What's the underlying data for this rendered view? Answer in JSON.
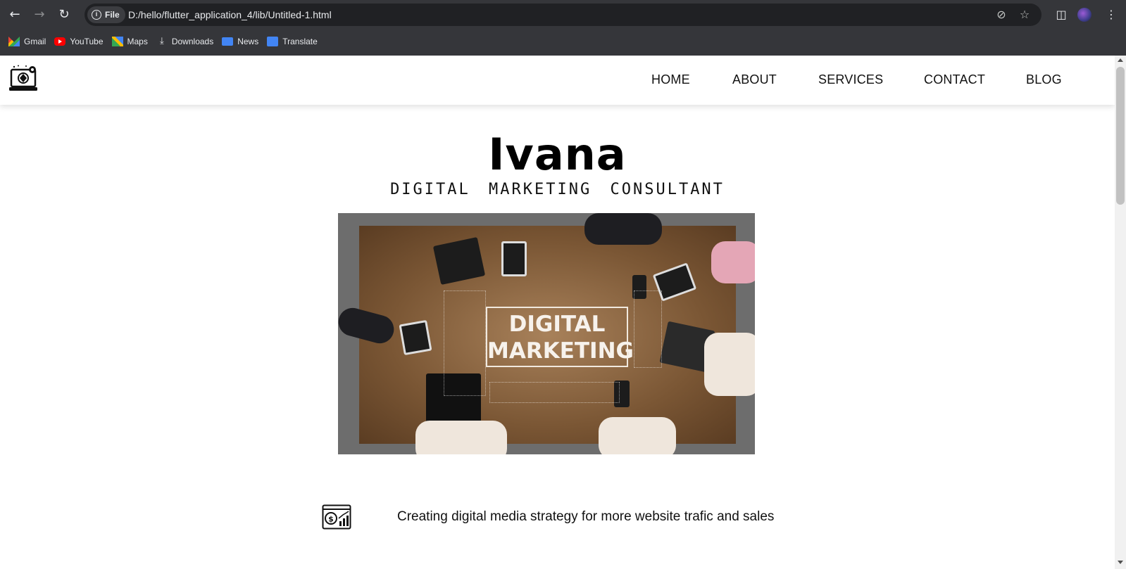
{
  "browser": {
    "file_chip_label": "File",
    "url": "D:/hello/flutter_application_4/lib/Untitled-1.html",
    "icons": {
      "back": "back-arrow-icon",
      "forward": "forward-arrow-icon",
      "reload": "reload-icon",
      "eye_off": "eye-off-icon",
      "star": "bookmark-star-icon",
      "side_panel": "side-panel-icon",
      "menu": "kebab-menu-icon"
    },
    "bookmarks": [
      {
        "label": "Gmail",
        "icon": "gmail-icon"
      },
      {
        "label": "YouTube",
        "icon": "youtube-icon"
      },
      {
        "label": "Maps",
        "icon": "maps-icon"
      },
      {
        "label": "Downloads",
        "icon": "download-icon"
      },
      {
        "label": "News",
        "icon": "news-icon"
      },
      {
        "label": "Translate",
        "icon": "translate-icon"
      }
    ]
  },
  "site": {
    "nav": [
      {
        "label": "HOME"
      },
      {
        "label": "ABOUT"
      },
      {
        "label": "SERVICES"
      },
      {
        "label": "CONTACT"
      },
      {
        "label": "BLOG"
      }
    ],
    "hero": {
      "name": "Ivana",
      "subtitle": "DIGITAL MARKETING CONSULTANT",
      "image_text_line1": "DIGITAL",
      "image_text_line2": "MARKETING"
    },
    "services": [
      {
        "icon": "money-chart-icon",
        "text": "Creating digital media strategy for more website trafic and sales"
      }
    ]
  },
  "colors": {
    "chrome_bg": "#35363a",
    "omnibox_bg": "#202124",
    "page_bg": "#ffffff",
    "text": "#111111"
  }
}
